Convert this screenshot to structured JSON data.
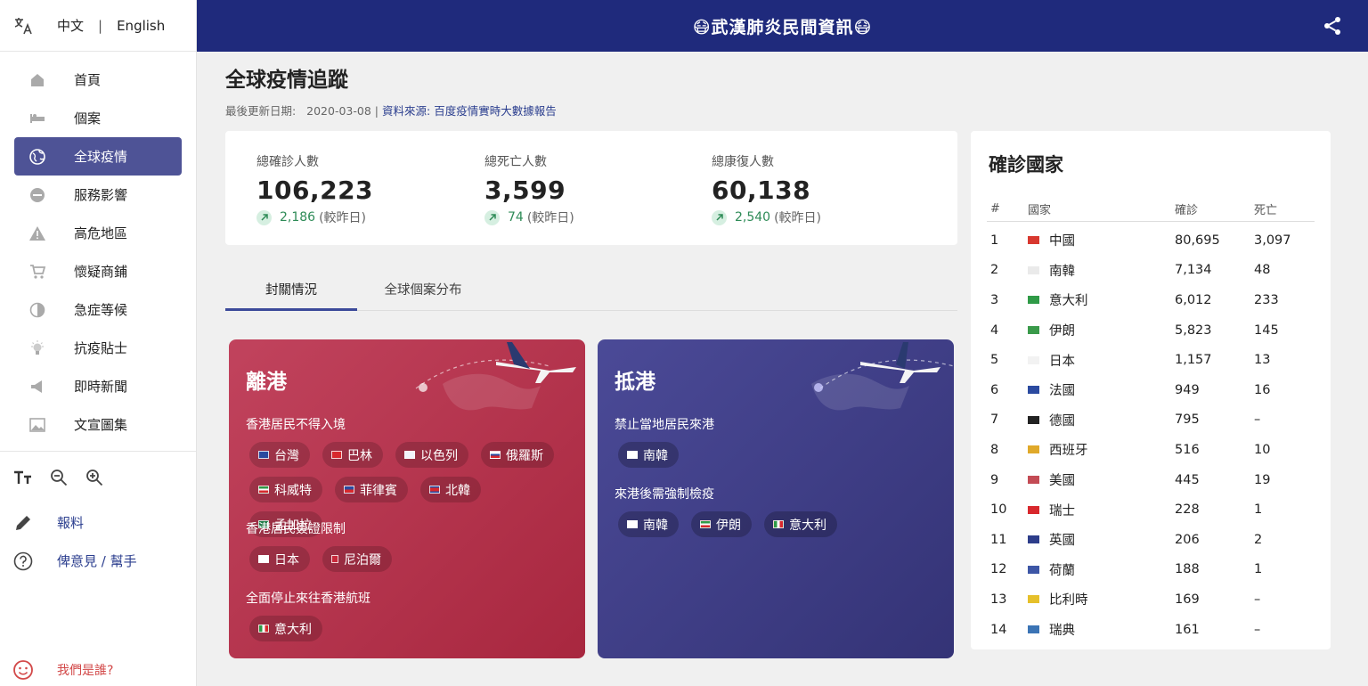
{
  "sidebar": {
    "lang": {
      "zh": "中文",
      "sep": "|",
      "en": "English"
    },
    "items": [
      {
        "label": "首頁",
        "icon": "home-icon"
      },
      {
        "label": "個案",
        "icon": "bed-icon"
      },
      {
        "label": "全球疫情",
        "icon": "globe-icon",
        "active": true
      },
      {
        "label": "服務影響",
        "icon": "minus-circle-icon"
      },
      {
        "label": "高危地區",
        "icon": "warning-icon"
      },
      {
        "label": "懷疑商鋪",
        "icon": "cart-icon"
      },
      {
        "label": "急症等候",
        "icon": "clock-icon"
      },
      {
        "label": "抗疫貼士",
        "icon": "lightbulb-icon"
      },
      {
        "label": "即時新聞",
        "icon": "megaphone-icon"
      },
      {
        "label": "文宣圖集",
        "icon": "image-icon"
      }
    ],
    "report": "報料",
    "feedback": "俾意見 / 幫手",
    "who": "我們是誰?"
  },
  "header": {
    "title": "😷武漢肺炎民間資訊😷"
  },
  "main": {
    "title": "全球疫情追蹤",
    "meta": {
      "updated_label": "最後更新日期:",
      "updated": "2020-03-08",
      "sep": "|",
      "source_label": "資料來源:",
      "source": "百度疫情實時大數據報告"
    },
    "stats": [
      {
        "label": "總確診人數",
        "value": "106,223",
        "change": "2,186",
        "note": "(較昨日)"
      },
      {
        "label": "總死亡人數",
        "value": "3,599",
        "change": "74",
        "note": "(較昨日)"
      },
      {
        "label": "總康復人數",
        "value": "60,138",
        "change": "2,540",
        "note": "(較昨日)"
      }
    ],
    "tabs": [
      {
        "label": "封關情況"
      },
      {
        "label": "全球個案分布"
      }
    ],
    "depart": {
      "heading": "離港",
      "groups": [
        {
          "title": "香港居民不得入境",
          "chips": [
            "台灣",
            "巴林",
            "以色列",
            "俄羅斯",
            "科威特",
            "菲律賓",
            "北韓",
            "孟加拉"
          ]
        },
        {
          "title": "香港居民簽證限制",
          "chips": [
            "日本",
            "尼泊爾"
          ]
        },
        {
          "title": "全面停止來往香港航班",
          "chips": [
            "意大利"
          ]
        }
      ]
    },
    "arrive": {
      "heading": "抵港",
      "groups": [
        {
          "title": "禁止當地居民來港",
          "chips": [
            "南韓"
          ]
        },
        {
          "title": "來港後需強制檢疫",
          "chips": [
            "南韓",
            "伊朗",
            "意大利"
          ]
        }
      ]
    }
  },
  "countries": {
    "title": "確診國家",
    "headers": [
      "#",
      "國家",
      "確診",
      "死亡"
    ],
    "rows": [
      {
        "n": "1",
        "name": "中國",
        "confirmed": "80,695",
        "deaths": "3,097",
        "flag": "#d8382f"
      },
      {
        "n": "2",
        "name": "南韓",
        "confirmed": "7,134",
        "deaths": "48",
        "flag": "#eaeaea"
      },
      {
        "n": "3",
        "name": "意大利",
        "confirmed": "6,012",
        "deaths": "233",
        "flag": "#2f9a47"
      },
      {
        "n": "4",
        "name": "伊朗",
        "confirmed": "5,823",
        "deaths": "145",
        "flag": "#3a9a4a"
      },
      {
        "n": "5",
        "name": "日本",
        "confirmed": "1,157",
        "deaths": "13",
        "flag": "#f2f2f2"
      },
      {
        "n": "6",
        "name": "法國",
        "confirmed": "949",
        "deaths": "16",
        "flag": "#2b4aa0"
      },
      {
        "n": "7",
        "name": "德國",
        "confirmed": "795",
        "deaths": "–",
        "flag": "#222222"
      },
      {
        "n": "8",
        "name": "西班牙",
        "confirmed": "516",
        "deaths": "10",
        "flag": "#e0a92a"
      },
      {
        "n": "9",
        "name": "美國",
        "confirmed": "445",
        "deaths": "19",
        "flag": "#c34b55"
      },
      {
        "n": "10",
        "name": "瑞士",
        "confirmed": "228",
        "deaths": "1",
        "flag": "#d8282d"
      },
      {
        "n": "11",
        "name": "英國",
        "confirmed": "206",
        "deaths": "2",
        "flag": "#2d3d8a"
      },
      {
        "n": "12",
        "name": "荷蘭",
        "confirmed": "188",
        "deaths": "1",
        "flag": "#3d56a6"
      },
      {
        "n": "13",
        "name": "比利時",
        "confirmed": "169",
        "deaths": "–",
        "flag": "#e6c02a"
      },
      {
        "n": "14",
        "name": "瑞典",
        "confirmed": "161",
        "deaths": "–",
        "flag": "#3b74b5"
      }
    ]
  },
  "colors": {
    "header": "#1f2a7c",
    "active_nav": "#4e5396",
    "depart": "#b53450",
    "arrive": "#3f3e86",
    "up": "#2e8b57"
  }
}
